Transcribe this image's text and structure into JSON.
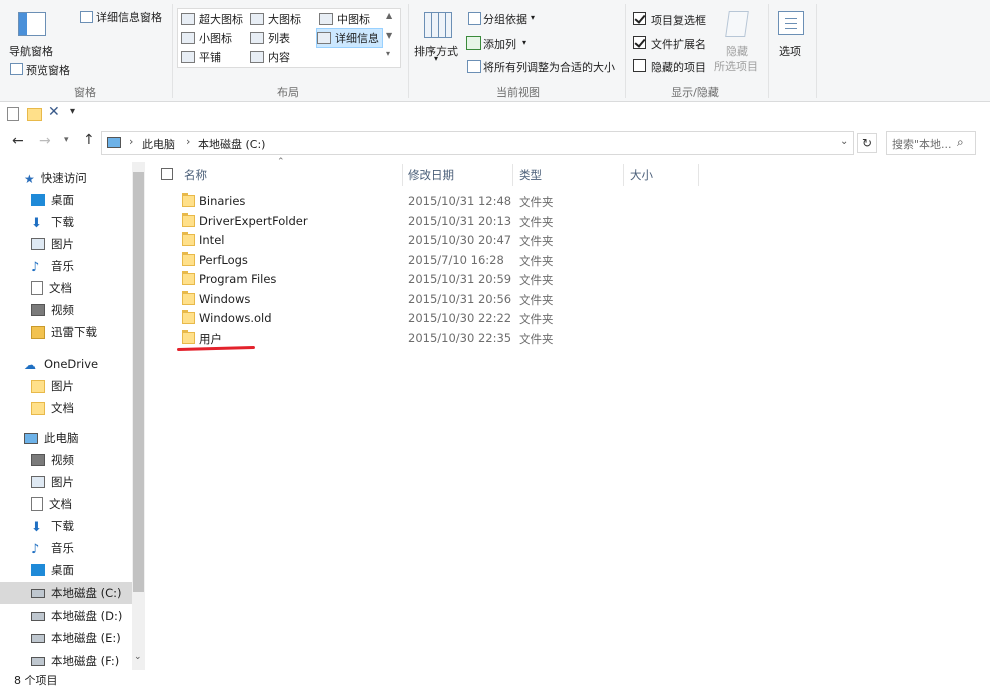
{
  "ribbon": {
    "pane_group": {
      "nav_pane": "导航窗格",
      "preview_pane": "预览窗格",
      "details_pane": "详细信息窗格",
      "label": "窗格"
    },
    "layout_group": {
      "items": [
        "超大图标",
        "大图标",
        "中图标",
        "小图标",
        "列表",
        "详细信息",
        "平铺",
        "内容"
      ],
      "selected": "详细信息",
      "label": "布局"
    },
    "current_view_group": {
      "sort_by": "排序方式",
      "group_by": "分组依据",
      "add_columns": "添加列",
      "size_all_columns": "将所有列调整为合适的大小",
      "label": "当前视图"
    },
    "show_hide_group": {
      "item_checkboxes": "项目复选框",
      "file_extensions": "文件扩展名",
      "hidden_items": "隐藏的项目",
      "hide_selected_1": "隐藏",
      "hide_selected_2": "所选项目",
      "label": "显示/隐藏",
      "item_checkboxes_checked": true,
      "file_extensions_checked": true,
      "hidden_items_checked": false
    },
    "options": "选项"
  },
  "address": {
    "crumbs": [
      "此电脑",
      "本地磁盘 (C:)"
    ],
    "search_placeholder": "搜索\"本地..."
  },
  "nav": {
    "quick_access": "快速访问",
    "quick_items": [
      "桌面",
      "下载",
      "图片",
      "音乐",
      "文档",
      "视频",
      "迅雷下载"
    ],
    "onedrive": "OneDrive",
    "onedrive_items": [
      "图片",
      "文档"
    ],
    "this_pc": "此电脑",
    "pc_items": [
      "视频",
      "图片",
      "文档",
      "下载",
      "音乐",
      "桌面",
      "本地磁盘 (C:)",
      "本地磁盘 (D:)",
      "本地磁盘 (E:)",
      "本地磁盘 (F:)"
    ],
    "selected": "本地磁盘 (C:)"
  },
  "columns": {
    "name": "名称",
    "modified": "修改日期",
    "type": "类型",
    "size": "大小"
  },
  "files": [
    {
      "name": "Binaries",
      "modified": "2015/10/31 12:48",
      "type": "文件夹"
    },
    {
      "name": "DriverExpertFolder",
      "modified": "2015/10/31 20:13",
      "type": "文件夹"
    },
    {
      "name": "Intel",
      "modified": "2015/10/30 20:47",
      "type": "文件夹"
    },
    {
      "name": "PerfLogs",
      "modified": "2015/7/10 16:28",
      "type": "文件夹"
    },
    {
      "name": "Program Files",
      "modified": "2015/10/31 20:59",
      "type": "文件夹"
    },
    {
      "name": "Windows",
      "modified": "2015/10/31 20:56",
      "type": "文件夹"
    },
    {
      "name": "Windows.old",
      "modified": "2015/10/30 22:22",
      "type": "文件夹"
    },
    {
      "name": "用户",
      "modified": "2015/10/30 22:35",
      "type": "文件夹"
    }
  ],
  "status": "8 个项目",
  "colors": {
    "accent_underline": "#e3222c",
    "selection": "#cce8ff",
    "nav_selected": "#d9d9d9"
  }
}
